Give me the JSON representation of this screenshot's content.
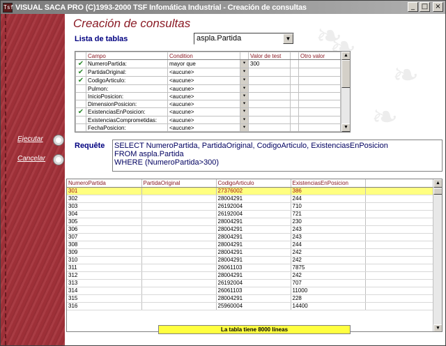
{
  "window": {
    "title": "VISUAL SACA PRO (C)1993-2000 TSF Infomática Industrial - Creación de consultas",
    "icon_text": "Tsf",
    "minimize_glyph": "_",
    "maximize_glyph": "□",
    "close_glyph": "×"
  },
  "sidebar": {
    "execute_label": "Ejecutar",
    "cancel_label": "Cancelar"
  },
  "header": {
    "title": "Creación de consultas",
    "tables_label": "Lista de tablas",
    "table_selected": "aspla.Partida"
  },
  "fields_grid": {
    "columns": [
      "",
      "Campo",
      "Condition",
      "",
      "Valor de test",
      "",
      "Otro valor"
    ],
    "rows": [
      {
        "checked": true,
        "field": "NumeroPartida:",
        "condition": "mayor que",
        "value": "300"
      },
      {
        "checked": true,
        "field": "PartidaOriginal:",
        "condition": "<aucune>",
        "value": ""
      },
      {
        "checked": true,
        "field": "CodigoArticulo:",
        "condition": "<aucune>",
        "value": ""
      },
      {
        "checked": false,
        "field": "Pulmon:",
        "condition": "<aucune>",
        "value": ""
      },
      {
        "checked": false,
        "field": "InicioPosicion:",
        "condition": "<aucune>",
        "value": ""
      },
      {
        "checked": false,
        "field": "DimensionPosicion:",
        "condition": "<aucune>",
        "value": ""
      },
      {
        "checked": true,
        "field": "ExistenciasEnPosicion:",
        "condition": "<aucune>",
        "value": ""
      },
      {
        "checked": false,
        "field": "ExistenciasComprometidas:",
        "condition": "<aucune>",
        "value": ""
      },
      {
        "checked": false,
        "field": "FechaPosicion:",
        "condition": "<aucune>",
        "value": ""
      }
    ]
  },
  "query": {
    "label": "Requête",
    "lines": [
      "SELECT NumeroPartida, PartidaOriginal, CodigoArticulo, ExistenciasEnPosicion",
      "FROM aspla.Partida",
      "WHERE (NumeroPartida>300)"
    ]
  },
  "results": {
    "columns": [
      "NumeroPartida",
      "PartidaOriginal",
      "CodigoArticulo",
      "ExistenciasEnPosicion",
      ""
    ],
    "rows": [
      [
        "301",
        "",
        "27376002",
        "386"
      ],
      [
        "302",
        "",
        "28004291",
        "244"
      ],
      [
        "303",
        "",
        "26192004",
        "710"
      ],
      [
        "304",
        "",
        "26192004",
        "721"
      ],
      [
        "305",
        "",
        "28004291",
        "230"
      ],
      [
        "306",
        "",
        "28004291",
        "243"
      ],
      [
        "307",
        "",
        "28004291",
        "243"
      ],
      [
        "308",
        "",
        "28004291",
        "244"
      ],
      [
        "309",
        "",
        "28004291",
        "242"
      ],
      [
        "310",
        "",
        "28004291",
        "242"
      ],
      [
        "311",
        "",
        "26061103",
        "7875"
      ],
      [
        "312",
        "",
        "28004291",
        "242"
      ],
      [
        "313",
        "",
        "26192004",
        "707"
      ],
      [
        "314",
        "",
        "26061103",
        "11000"
      ],
      [
        "315",
        "",
        "28004291",
        "228"
      ],
      [
        "316",
        "",
        "25960004",
        "14400"
      ]
    ],
    "selected_row": 0
  },
  "status": {
    "text": "La tabla tiene 8000 líneas"
  },
  "glyphs": {
    "check": "✔",
    "dropdown": "▼",
    "cell_dropdown": "⯆",
    "scroll_up": "▲",
    "scroll_down": "▼",
    "leaf": "❧"
  },
  "colors": {
    "sidebar": "#a4323a",
    "title_text": "#8a1a24",
    "selected_row": "#ffff80",
    "status_bar": "#ffff40",
    "check": "#2e8a2e"
  }
}
